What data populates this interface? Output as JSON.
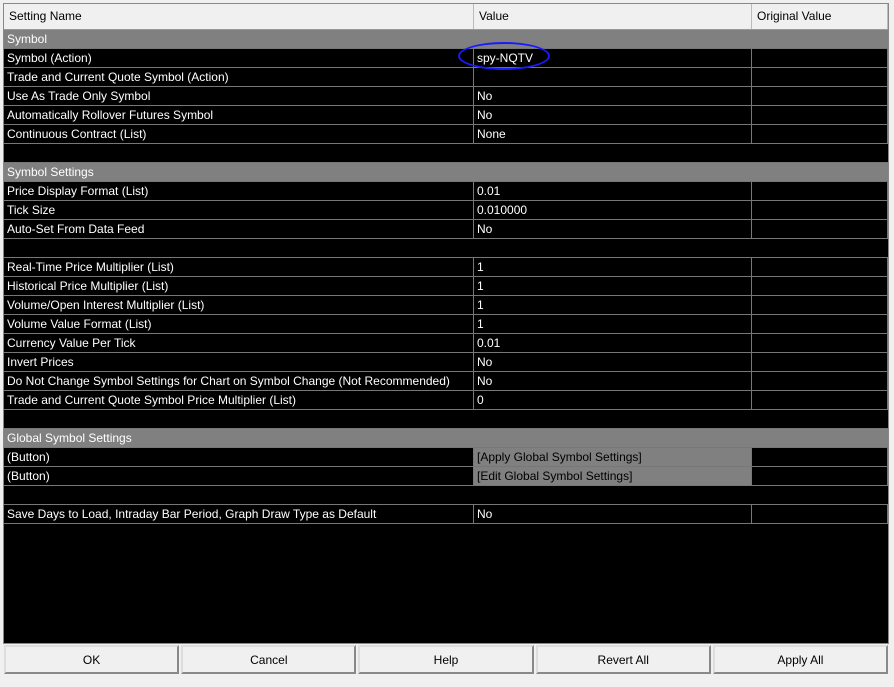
{
  "columns": {
    "name": "Setting Name",
    "value": "Value",
    "original": "Original Value"
  },
  "rows": [
    {
      "type": "group",
      "name": "Symbol"
    },
    {
      "name": "Symbol (Action)",
      "value": "spy-NQTV"
    },
    {
      "name": "Trade and Current Quote Symbol (Action)",
      "value": ""
    },
    {
      "name": "Use As Trade Only Symbol",
      "value": "No"
    },
    {
      "name": "Automatically Rollover Futures Symbol",
      "value": "No"
    },
    {
      "name": "Continuous Contract (List)",
      "value": "None"
    },
    {
      "type": "blank"
    },
    {
      "type": "group",
      "name": "Symbol Settings"
    },
    {
      "name": "Price Display Format (List)",
      "value": "0.01"
    },
    {
      "name": "Tick Size",
      "value": "0.010000"
    },
    {
      "name": "Auto-Set From Data Feed",
      "value": "No"
    },
    {
      "type": "blank"
    },
    {
      "name": "Real-Time Price Multiplier (List)",
      "value": "1"
    },
    {
      "name": "Historical Price Multiplier (List)",
      "value": "1"
    },
    {
      "name": "Volume/Open Interest Multiplier (List)",
      "value": "1"
    },
    {
      "name": "Volume Value Format (List)",
      "value": "1"
    },
    {
      "name": "Currency Value Per Tick",
      "value": "0.01"
    },
    {
      "name": "Invert Prices",
      "value": "No"
    },
    {
      "name": "Do Not Change Symbol Settings for Chart on Symbol Change (Not Recommended)",
      "value": "No"
    },
    {
      "name": "Trade and Current Quote Symbol Price Multiplier (List)",
      "value": "0"
    },
    {
      "type": "blank"
    },
    {
      "type": "group",
      "name": "Global Symbol Settings"
    },
    {
      "type": "button",
      "name": " (Button)",
      "value": "[Apply Global Symbol Settings]"
    },
    {
      "type": "button",
      "name": " (Button)",
      "value": "[Edit Global Symbol Settings]"
    },
    {
      "type": "blank"
    },
    {
      "name": "Save Days to Load, Intraday Bar Period, Graph Draw Type as Default",
      "value": "No"
    }
  ],
  "buttons": {
    "ok": "OK",
    "cancel": "Cancel",
    "help": "Help",
    "revert": "Revert All",
    "apply": "Apply All"
  },
  "annotation_color": "#1a1aff"
}
